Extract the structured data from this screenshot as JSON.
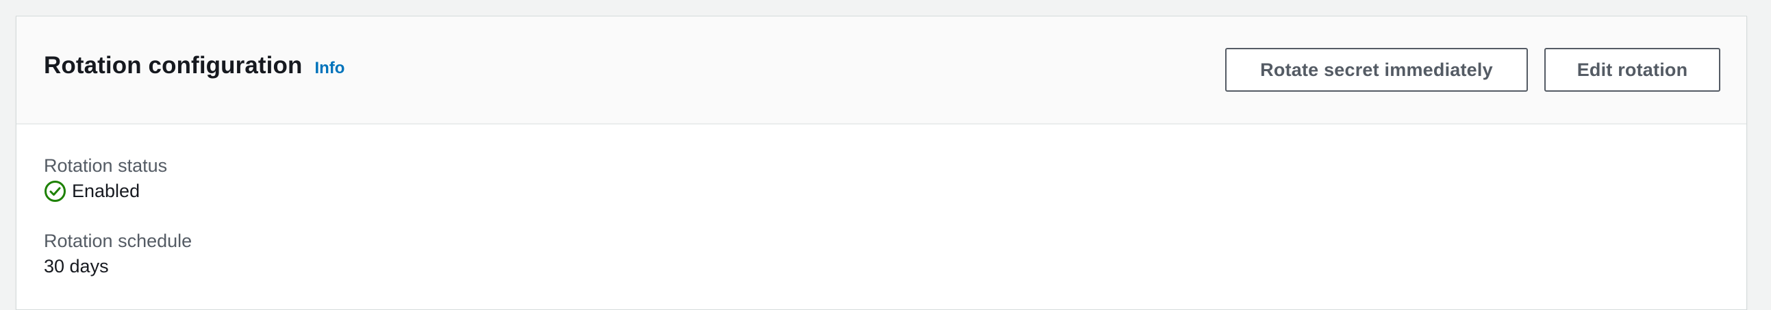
{
  "panel": {
    "title": "Rotation configuration",
    "info_label": "Info",
    "actions": {
      "rotate_label": "Rotate secret immediately",
      "edit_label": "Edit rotation"
    }
  },
  "fields": {
    "status": {
      "label": "Rotation status",
      "value": "Enabled",
      "icon": "check-circle-icon",
      "icon_color": "#1d8102"
    },
    "schedule": {
      "label": "Rotation schedule",
      "value": "30 days"
    }
  }
}
